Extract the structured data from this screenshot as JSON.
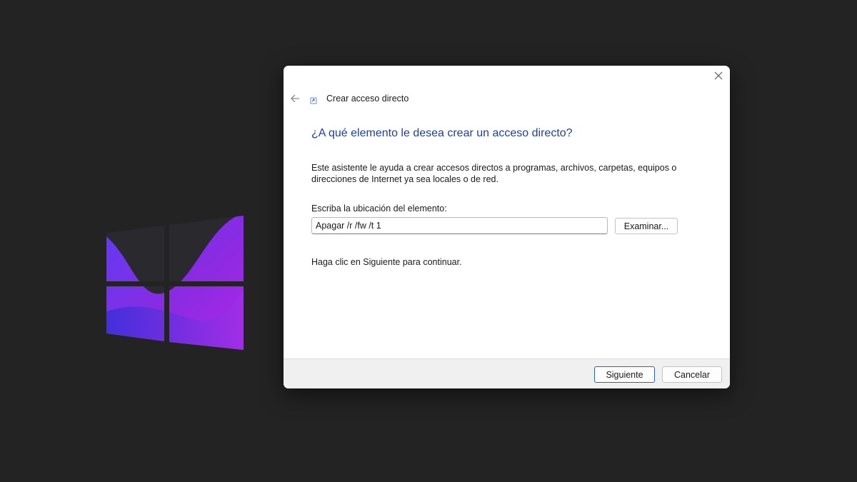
{
  "dialog": {
    "header_title": "Crear acceso directo",
    "main_title": "¿A qué elemento le desea crear un acceso directo?",
    "description": "Este asistente le ayuda a crear accesos directos a programas, archivos, carpetas, equipos o direcciones de Internet ya sea locales o de red.",
    "location_label": "Escriba la ubicación del elemento:",
    "location_value": "Apagar /r /fw /t 1",
    "browse_label": "Examinar...",
    "hint": "Haga clic en Siguiente para continuar.",
    "next_label": "Siguiente",
    "cancel_label": "Cancelar"
  },
  "icons": {
    "close": "close-icon",
    "back": "back-arrow-icon",
    "wizard": "shortcut-wizard-icon",
    "logo": "windows-logo-icon"
  },
  "colors": {
    "background": "#232323",
    "title_blue": "#1f3f9a",
    "accent_border": "#2b62c4",
    "logo_violet": "#6d28d9",
    "logo_magenta": "#a21caf"
  }
}
